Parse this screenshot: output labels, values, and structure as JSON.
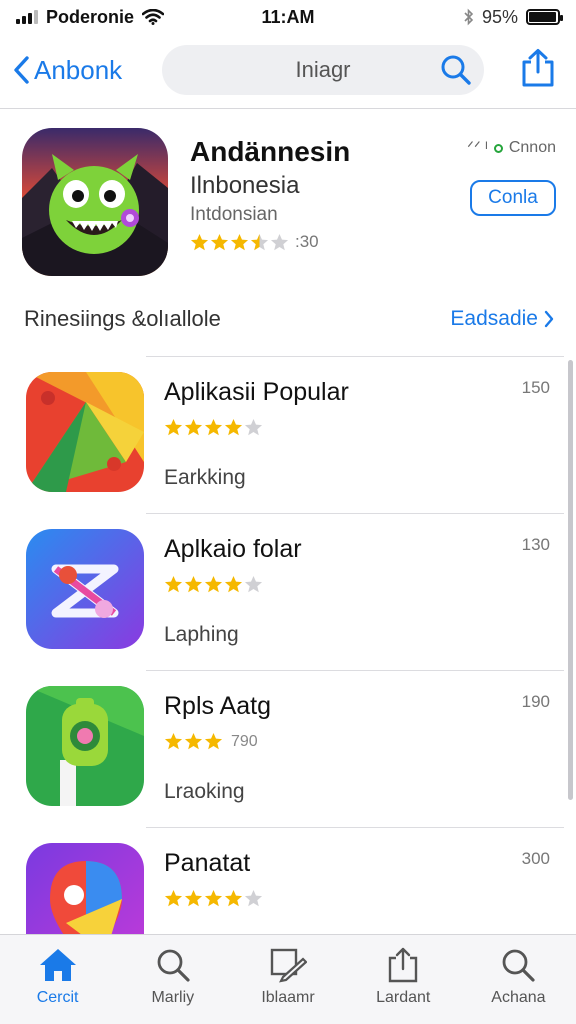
{
  "status_bar": {
    "carrier": "Poderonie",
    "time": "11:AM",
    "battery": "95%",
    "battery_level": 0.95
  },
  "nav": {
    "back_label": "Anbonk",
    "search_text": "Iniagr"
  },
  "featured": {
    "title": "Andännesin",
    "subtitle": "Ilnbonesia",
    "subtitle2": "Intdonsian",
    "rating": 3.5,
    "rating_count": ":30",
    "meta_left": "ᐟᐟ ᴵ",
    "meta_right": "Cnnon",
    "button_label": "Conla"
  },
  "section": {
    "title": "Rinesiings &olıallole",
    "see_all": "Eadsadie"
  },
  "apps": [
    {
      "name": "Aplikasii Popular",
      "rating": 4,
      "rating_count": "",
      "category": "Earkking",
      "size": "150"
    },
    {
      "name": "Aplkaio folar",
      "rating": 4,
      "rating_count": "",
      "category": "Laphing",
      "size": "130"
    },
    {
      "name": "Rpls Aatg",
      "rating": 3,
      "rating_count": "790",
      "category": "Lraoking",
      "size": "190"
    },
    {
      "name": "Panatat",
      "rating": 4,
      "rating_count": "",
      "category": "",
      "size": "300"
    }
  ],
  "tabs": [
    {
      "label": "Cercit",
      "icon": "home-icon"
    },
    {
      "label": "Marliy",
      "icon": "search-icon"
    },
    {
      "label": "Iblaamr",
      "icon": "edit-icon"
    },
    {
      "label": "Lardant",
      "icon": "share-icon"
    },
    {
      "label": "Achana",
      "icon": "search-icon"
    }
  ],
  "colors": {
    "accent": "#1a7ae8",
    "star": "#f5b800",
    "star_empty": "#d0d0d4"
  }
}
